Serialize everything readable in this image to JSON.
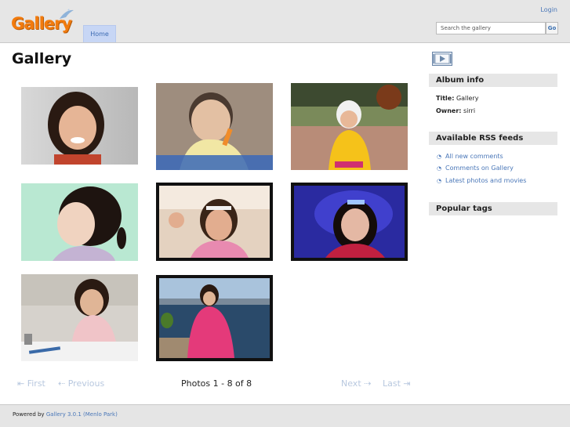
{
  "header": {
    "logo_text": "Gallery",
    "login": "Login",
    "search": {
      "placeholder": "Search the gallery",
      "value": "",
      "button": "Go"
    },
    "nav": {
      "home": "Home"
    }
  },
  "main": {
    "title": "Gallery",
    "thumbnails": [
      {
        "name": "photo-1",
        "scene": "girl-smiling-grey-background"
      },
      {
        "name": "photo-2",
        "scene": "baby-holding-carrot"
      },
      {
        "name": "photo-3",
        "scene": "child-in-yellow-coat-outdoors"
      },
      {
        "name": "photo-4",
        "scene": "girl-profile-mint-background"
      },
      {
        "name": "photo-5",
        "scene": "girl-waving-framed"
      },
      {
        "name": "photo-6",
        "scene": "girl-looking-up-blue-lights"
      },
      {
        "name": "photo-7",
        "scene": "child-drawing-at-table"
      },
      {
        "name": "photo-8",
        "scene": "girl-in-pink-coat-seaside"
      }
    ],
    "pager": {
      "first": "First",
      "previous": "Previous",
      "info": "Photos 1 - 8 of 8",
      "next": "Next",
      "last": "Last"
    }
  },
  "sidebar": {
    "slideshow_icon": "slideshow-play-icon",
    "album_info": {
      "title": "Album info",
      "title_label": "Title:",
      "title_value": "Gallery",
      "owner_label": "Owner:",
      "owner_value": "sirri"
    },
    "rss": {
      "title": "Available RSS feeds",
      "items": [
        "All new comments",
        "Comments on Gallery",
        "Latest photos and movies"
      ]
    },
    "tags": {
      "title": "Popular tags"
    }
  },
  "footer": {
    "powered_by": "Powered by",
    "product": "Gallery 3.0.1",
    "codename": "(Menlo Park)"
  },
  "colors": {
    "accent": "#4a77b8",
    "logo": "#f27b0e",
    "nav_active": "#c7d6f5",
    "block_header": "#e6e6e6"
  }
}
